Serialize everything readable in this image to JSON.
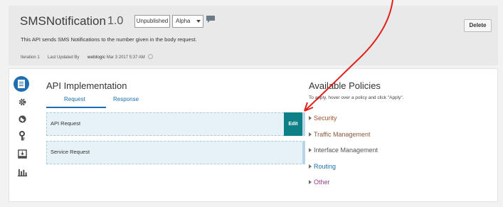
{
  "header": {
    "title": "SMSNotification",
    "version": "1.0",
    "status_label": "Unpublished",
    "channel_value": "Alpha",
    "delete_label": "Delete",
    "description": "This API sends SMS Notifications to the number given in the body request.",
    "meta": {
      "iteration_label": "Iteration",
      "iteration_value": "1",
      "updated_label": "Last Updated By",
      "updated_user": "weblogic",
      "updated_date": "Mar 3 2017 5:37 AM"
    }
  },
  "sidebar": {
    "items": [
      {
        "icon": "document-icon",
        "active": true
      },
      {
        "icon": "gear-icon",
        "active": false
      },
      {
        "icon": "globe-icon",
        "active": false
      },
      {
        "icon": "key-icon",
        "active": false
      },
      {
        "icon": "deploy-icon",
        "active": false
      },
      {
        "icon": "analytics-icon",
        "active": false
      }
    ]
  },
  "implementation": {
    "title": "API Implementation",
    "tabs": [
      "Request",
      "Response"
    ],
    "active_tab": "Request",
    "boxes": [
      "API Request",
      "Service Request"
    ],
    "edit_label": "Edit"
  },
  "policies": {
    "title": "Available Policies",
    "hint": "To apply, hover over a policy and click \"Apply\".",
    "items": [
      "Security",
      "Traffic Management",
      "Interface Management",
      "Routing",
      "Other"
    ]
  },
  "colors": {
    "accent": "#1f6fb0",
    "edit_button": "#0d7f86",
    "annotation_arrow": "#e0201a"
  }
}
